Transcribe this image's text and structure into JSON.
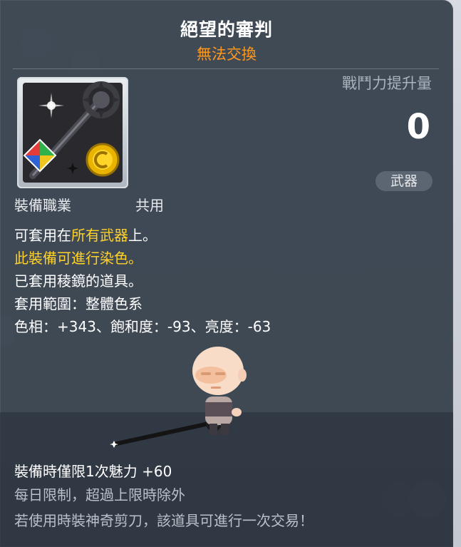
{
  "item": {
    "name": "絕望的審判",
    "trade_status": "無法交換",
    "icon_name": "scepter-item-icon"
  },
  "stats": {
    "power_label": "戰鬥力提升量",
    "power_value": "0",
    "category": "武器"
  },
  "job": {
    "label": "裝備職業",
    "value": "共用"
  },
  "description": {
    "line1_prefix": "可套用在",
    "line1_highlight": "所有武器",
    "line1_suffix": "上。",
    "line2": "此裝備可進行染色。",
    "line3": "已套用稜鏡的道具。",
    "line4": "套用範圍：整體色系",
    "line5": "色相：+343、飽和度：-93、亮度：-63"
  },
  "footer": {
    "charm": "裝備時僅限1次魅力 +60",
    "daily_limit": "每日限制，超過上限時除外",
    "scissors": "若使用時裝神奇剪刀，該道具可進行一次交易！"
  },
  "colors": {
    "title": "#ffffff",
    "untradeable": "#ff9a1f",
    "highlight": "#ffd229",
    "panel": "#343e4a"
  }
}
